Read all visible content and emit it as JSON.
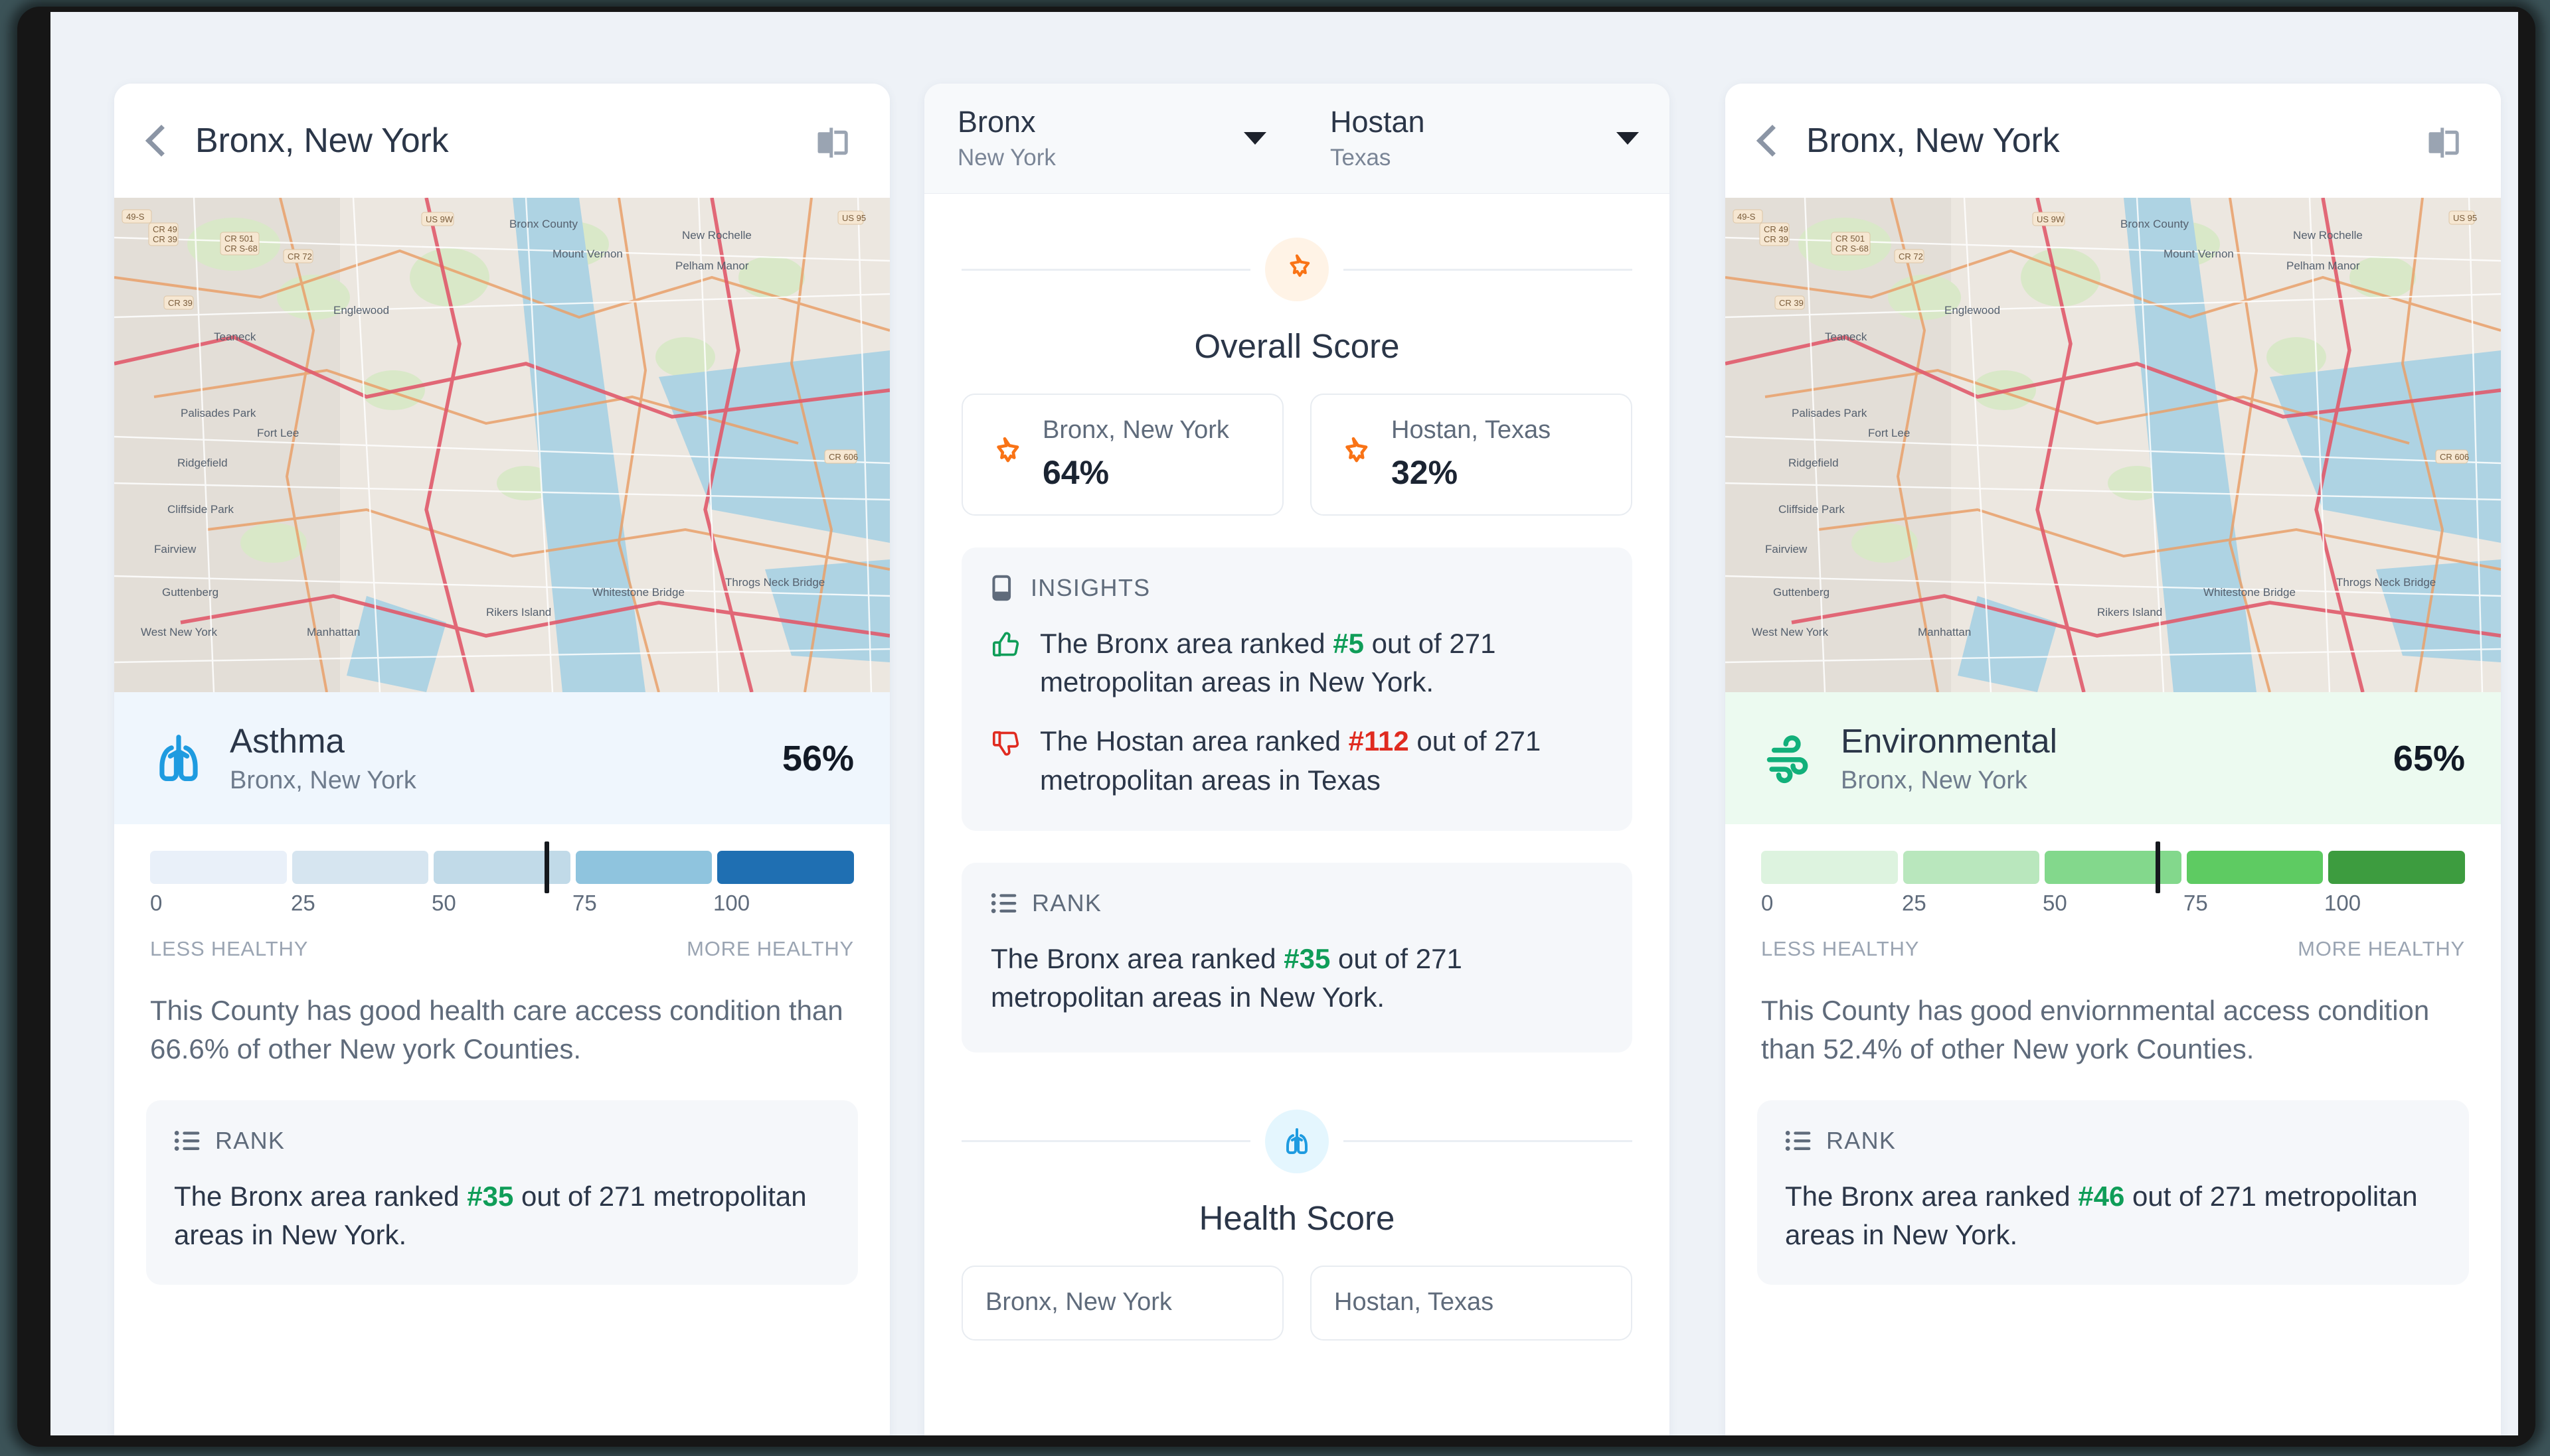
{
  "left_panel": {
    "header": {
      "title": "Bronx, New York",
      "back_icon": "chevron-left-icon",
      "compare_icon": "compare-split-icon"
    },
    "map": {
      "alt": "street map of Bronx, New York"
    },
    "metric": {
      "icon": "lungs-icon",
      "name": "Asthma",
      "location": "Bronx, New York",
      "percent": "56%",
      "accent": "#1e9be0",
      "head_bg": "#eff6fd"
    },
    "scale": {
      "ticks": [
        "0",
        "25",
        "50",
        "75",
        "100"
      ],
      "marker_value": 56,
      "left_label": "LESS HEALTHY",
      "right_label": "MORE HEALTHY",
      "colors": [
        "#e9f0f9",
        "#d6e5f0",
        "#c1dae8",
        "#8fc4de",
        "#1f6fb2"
      ]
    },
    "summary": "This County has good health care access condition than 66.6% of other New york Counties.",
    "rank": {
      "icon": "list-icon",
      "label": "RANK",
      "text_before": "The Bronx area ranked ",
      "rank_number": "#35",
      "text_after": " out of 271 metropolitan areas in New York."
    }
  },
  "middle_panel": {
    "selects": [
      {
        "county": "Bronx",
        "state": "New York",
        "caret": "chevron-down-icon"
      },
      {
        "county": "Hostan",
        "state": "Texas",
        "caret": "chevron-down-icon"
      }
    ],
    "sections": [
      {
        "badge_icon": "star-award-icon",
        "badge_tone": "orange",
        "title": "Overall Score",
        "scores": [
          {
            "icon": "star-award-icon",
            "place": "Bronx, New York",
            "value": "64%"
          },
          {
            "icon": "star-award-icon",
            "place": "Hostan, Texas",
            "value": "32%"
          }
        ]
      }
    ],
    "insights": {
      "icon": "monitor-icon",
      "label": "INSIGHTS",
      "items": [
        {
          "icon": "thumbs-up-icon",
          "tone": "good",
          "text_before": "The Bronx area ranked ",
          "rank_number": "#5",
          "text_after": " out of 271 metropolitan areas in New York."
        },
        {
          "icon": "thumbs-down-icon",
          "tone": "bad",
          "text_before": "The Hostan area ranked ",
          "rank_number": "#112",
          "text_after": " out of 271 metropolitan areas in Texas"
        }
      ]
    },
    "rank": {
      "icon": "list-icon",
      "label": "RANK",
      "text_before": "The Bronx area ranked ",
      "rank_number": "#35",
      "text_after": " out of 271 metropolitan areas in New York."
    },
    "health_section": {
      "badge_icon": "lungs-icon",
      "badge_tone": "blue",
      "title": "Health Score",
      "scores": [
        {
          "place": "Bronx, New York"
        },
        {
          "place": "Hostan, Texas"
        }
      ]
    }
  },
  "right_panel": {
    "header": {
      "title": "Bronx, New York",
      "back_icon": "chevron-left-icon",
      "compare_icon": "compare-split-icon"
    },
    "map": {
      "alt": "street map of Bronx, New York"
    },
    "metric": {
      "icon": "wind-icon",
      "name": "Environmental",
      "location": "Bronx, New York",
      "percent": "65%",
      "accent": "#12b07a",
      "head_bg": "#ecfaf0"
    },
    "scale": {
      "ticks": [
        "0",
        "25",
        "50",
        "75",
        "100"
      ],
      "marker_value": 56,
      "left_label": "LESS HEALTHY",
      "right_label": "MORE HEALTHY",
      "colors": [
        "#ddf3df",
        "#b9e7bd",
        "#83d88c",
        "#5ecb62",
        "#3d9c3f"
      ]
    },
    "summary": "This County has good enviornmental access condition than 52.4% of other New york Counties.",
    "rank": {
      "icon": "list-icon",
      "label": "RANK",
      "text_before": "The Bronx area ranked ",
      "rank_number": "#46",
      "text_after": " out of 271 metropolitan areas in New York."
    }
  },
  "theme": {
    "good_color": "#0f9d58",
    "bad_color": "#e02b20",
    "orange": "#f97316",
    "page_bg": "#eef2f7"
  }
}
